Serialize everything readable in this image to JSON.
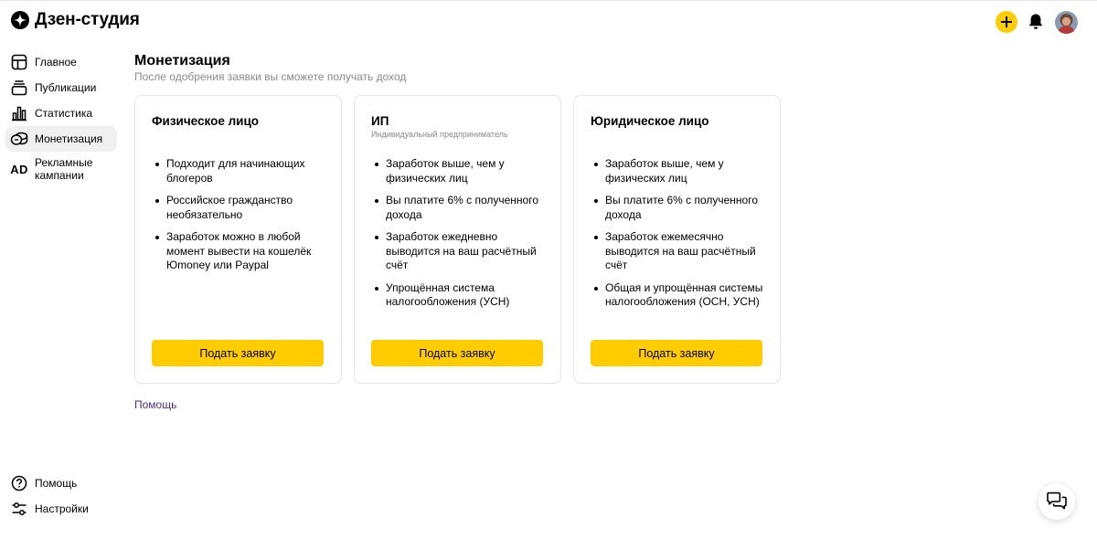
{
  "app": {
    "title": "Дзен-студия"
  },
  "header": {
    "create_icon": "plus-icon",
    "notifications_icon": "bell-icon",
    "avatar_icon": "user-avatar"
  },
  "sidebar": {
    "items": [
      {
        "label": "Главное",
        "icon": "home-icon",
        "active": false
      },
      {
        "label": "Публикации",
        "icon": "publications-icon",
        "active": false
      },
      {
        "label": "Статистика",
        "icon": "statistics-icon",
        "active": false
      },
      {
        "label": "Монетизация",
        "icon": "monetization-icon",
        "active": true
      },
      {
        "label": "Рекламные кампании",
        "icon": "ad-icon",
        "icon_text": "AD",
        "active": false
      }
    ],
    "bottom_items": [
      {
        "label": "Помощь",
        "icon": "help-icon"
      },
      {
        "label": "Настройки",
        "icon": "settings-icon"
      }
    ]
  },
  "main": {
    "title": "Монетизация",
    "subtitle": "После одобрения заявки вы сможете получать доход",
    "cards": [
      {
        "title": "Физическое лицо",
        "subtitle": "",
        "bullets": [
          "Подходит для начинающих блогеров",
          "Российское гражданство необязательно",
          "Заработок можно в любой момент вывести на кошелёк Юmoney или Paypal"
        ],
        "button": "Подать заявку"
      },
      {
        "title": "ИП",
        "subtitle": "Индивидуальный предприниматель",
        "bullets": [
          "Заработок выше, чем у физических лиц",
          "Вы платите 6% с полученного дохода",
          "Заработок ежедневно выводится на ваш расчётный счёт",
          "Упрощённая система налогообложения (УСН)"
        ],
        "button": "Подать заявку"
      },
      {
        "title": "Юридическое лицо",
        "subtitle": "",
        "bullets": [
          "Заработок выше, чем у физических лиц",
          "Вы платите 6% с полученного дохода",
          "Заработок ежемесячно выводится на ваш расчётный счёт",
          "Общая и упрощённая системы налогообложения (ОСН, УСН)"
        ],
        "button": "Подать заявку"
      }
    ],
    "help_link": "Помощь"
  },
  "chat": {
    "icon": "chat-support-icon"
  },
  "colors": {
    "accent": "#ffcc00",
    "link": "#4b2e83",
    "muted": "#8a8a8a",
    "active_bg": "#f0f0f0"
  }
}
